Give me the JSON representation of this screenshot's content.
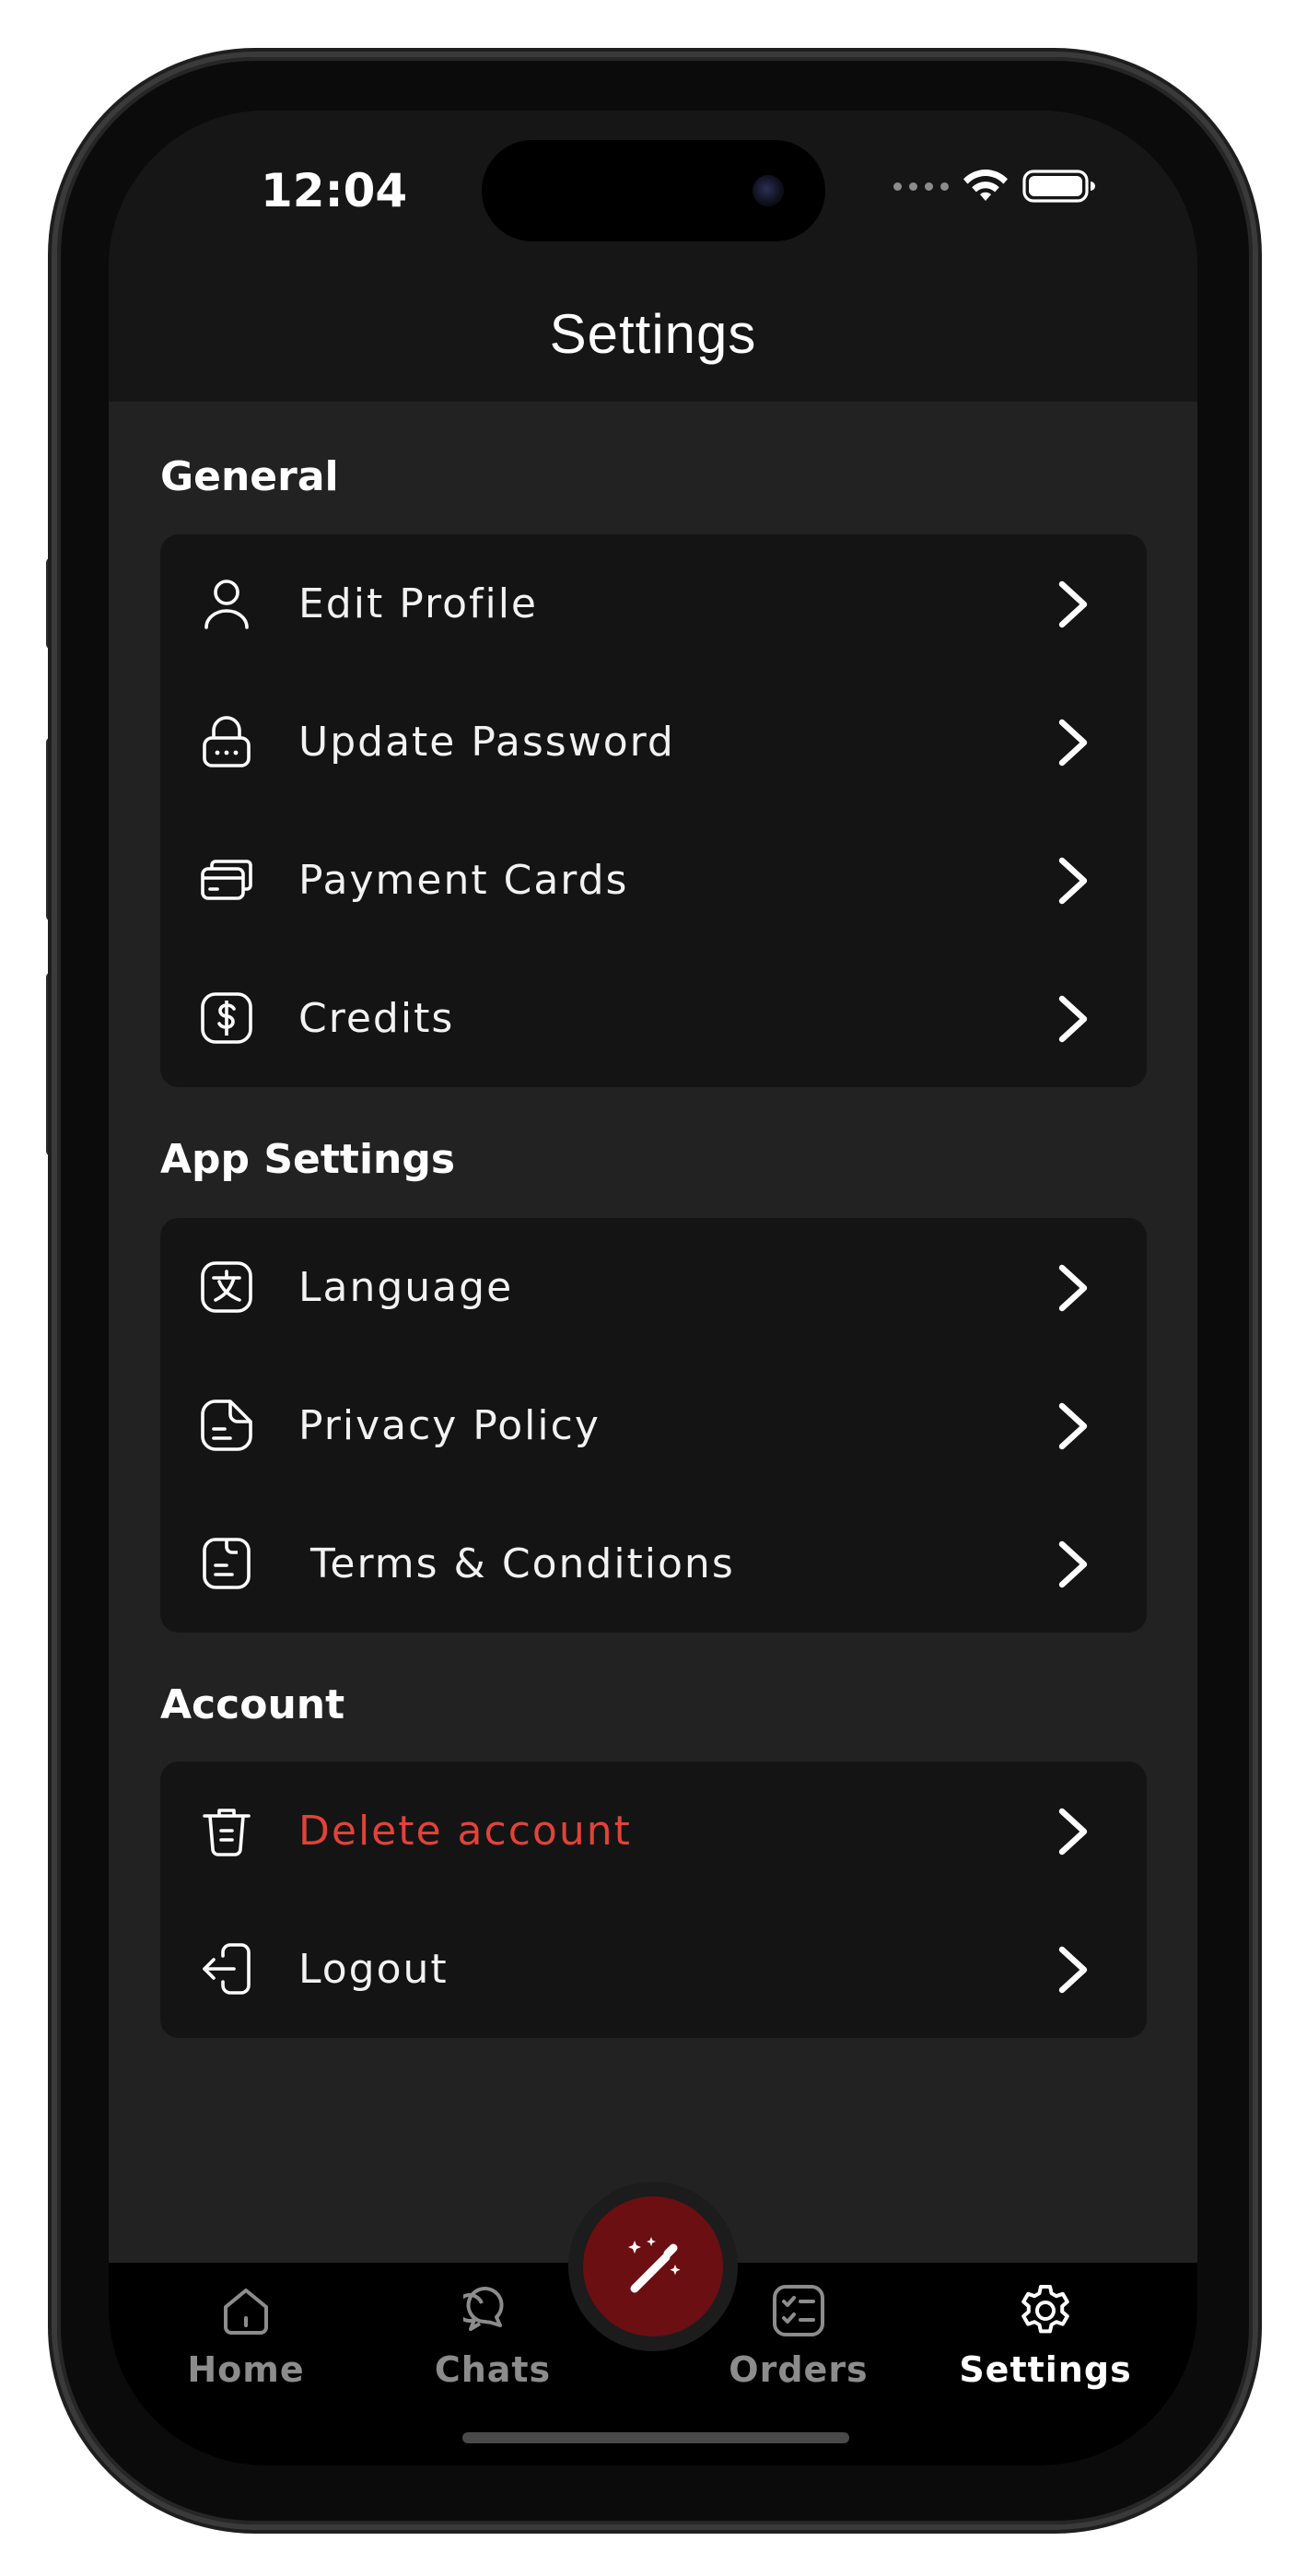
{
  "status_bar": {
    "time": "12:04"
  },
  "header": {
    "title": "Settings"
  },
  "sections": [
    {
      "title": "General",
      "items": [
        {
          "label": "Edit Profile",
          "icon": "user-icon"
        },
        {
          "label": "Update Password",
          "icon": "lock-icon"
        },
        {
          "label": "Payment Cards",
          "icon": "cards-icon"
        },
        {
          "label": "Credits",
          "icon": "dollar-icon"
        }
      ]
    },
    {
      "title": "App Settings",
      "items": [
        {
          "label": "Language",
          "icon": "translate-icon"
        },
        {
          "label": "Privacy Policy",
          "icon": "document-icon"
        },
        {
          "label": "Terms & Conditions",
          "icon": "file-text-icon"
        }
      ]
    },
    {
      "title": "Account",
      "items": [
        {
          "label": "Delete account",
          "icon": "trash-icon",
          "color": "#e0433a"
        },
        {
          "label": "Logout",
          "icon": "logout-icon"
        }
      ]
    }
  ],
  "bottom_nav": {
    "items": [
      {
        "label": "Home",
        "icon": "home-icon"
      },
      {
        "label": "Chats",
        "icon": "chat-bubbles-icon"
      },
      {
        "label": "Orders",
        "icon": "checklist-icon"
      },
      {
        "label": "Settings",
        "icon": "gear-icon"
      }
    ],
    "active": "Settings",
    "fab_icon": "magic-wand-icon"
  },
  "colors": {
    "accent_fab": "#6b0f12",
    "danger": "#e0433a",
    "background": "#222222",
    "card": "#141414"
  }
}
